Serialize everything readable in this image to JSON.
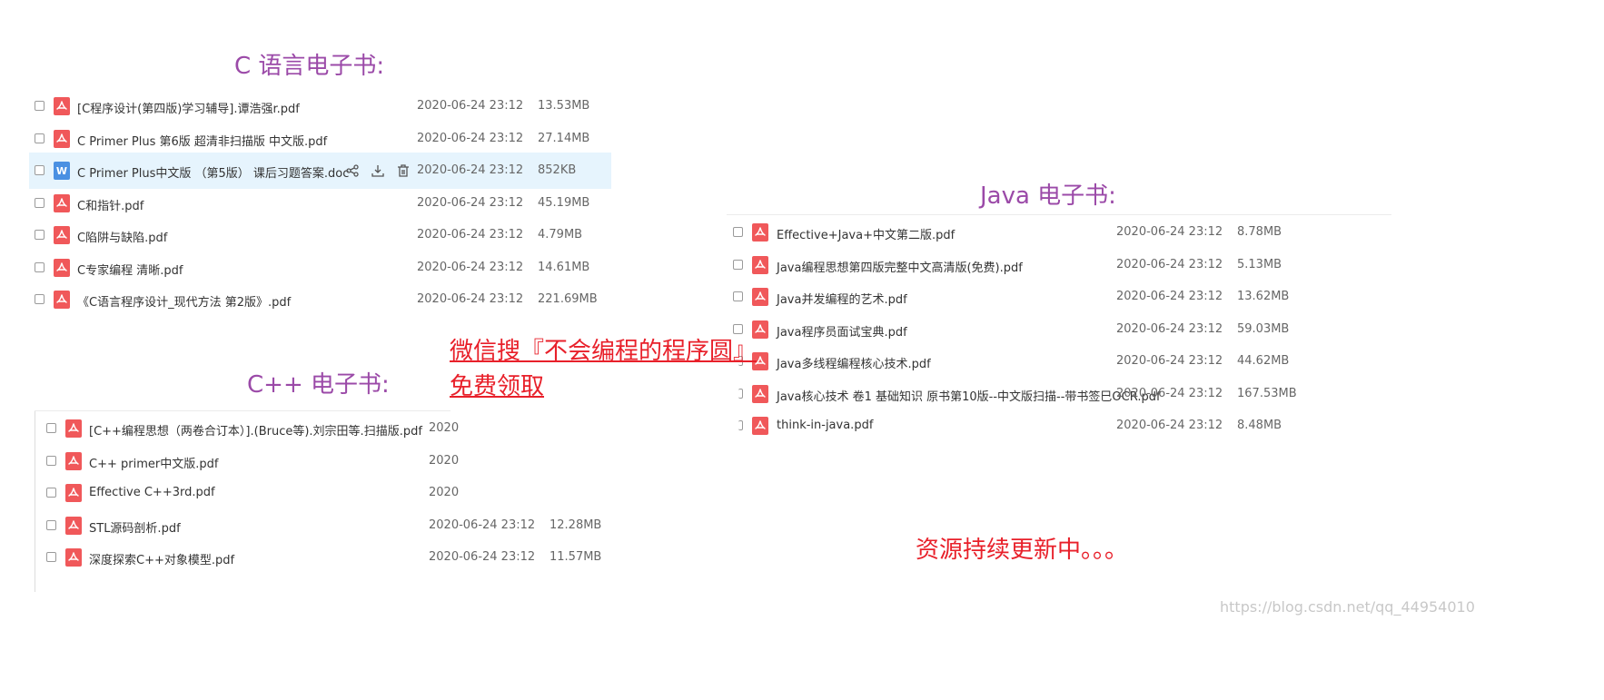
{
  "sections": {
    "c": {
      "title": "C 语言电子书:",
      "files": [
        {
          "name": "[C程序设计(第四版)学习辅导].谭浩强r.pdf",
          "date": "2020-06-24 23:12",
          "size": "13.53MB",
          "type": "pdf"
        },
        {
          "name": "C Primer Plus 第6版 超清非扫描版 中文版.pdf",
          "date": "2020-06-24 23:12",
          "size": "27.14MB",
          "type": "pdf"
        },
        {
          "name": "C Primer Plus中文版 （第5版） 课后习题答案.doc",
          "date": "2020-06-24 23:12",
          "size": "852KB",
          "type": "doc"
        },
        {
          "name": "C和指针.pdf",
          "date": "2020-06-24 23:12",
          "size": "45.19MB",
          "type": "pdf"
        },
        {
          "name": "C陷阱与缺陷.pdf",
          "date": "2020-06-24 23:12",
          "size": "4.79MB",
          "type": "pdf"
        },
        {
          "name": "C专家编程 清晰.pdf",
          "date": "2020-06-24 23:12",
          "size": "14.61MB",
          "type": "pdf"
        },
        {
          "name": "《C语言程序设计_现代方法 第2版》.pdf",
          "date": "2020-06-24 23:12",
          "size": "221.69MB",
          "type": "pdf"
        }
      ]
    },
    "cpp": {
      "title": "C++ 电子书:",
      "files": [
        {
          "name": "[C++编程思想（两卷合订本）].(Bruce等).刘宗田等.扫描版.pdf",
          "date": "2020",
          "size": "",
          "type": "pdf"
        },
        {
          "name": "C++ primer中文版.pdf",
          "date": "2020",
          "size": "",
          "type": "pdf"
        },
        {
          "name": "Effective C++3rd.pdf",
          "date": "2020",
          "size": "",
          "type": "pdf"
        },
        {
          "name": "STL源码剖析.pdf",
          "date": "2020-06-24 23:12",
          "size": "12.28MB",
          "type": "pdf"
        },
        {
          "name": "深度探索C++对象模型.pdf",
          "date": "2020-06-24 23:12",
          "size": "11.57MB",
          "type": "pdf"
        }
      ]
    },
    "java": {
      "title": "Java 电子书:",
      "files": [
        {
          "name": "Effective+Java+中文第二版.pdf",
          "date": "2020-06-24 23:12",
          "size": "8.78MB",
          "type": "pdf"
        },
        {
          "name": "Java编程思想第四版完整中文高清版(免费).pdf",
          "date": "2020-06-24 23:12",
          "size": "5.13MB",
          "type": "pdf"
        },
        {
          "name": "Java并发编程的艺术.pdf",
          "date": "2020-06-24 23:12",
          "size": "13.62MB",
          "type": "pdf"
        },
        {
          "name": "Java程序员面试宝典.pdf",
          "date": "2020-06-24 23:12",
          "size": "59.03MB",
          "type": "pdf"
        },
        {
          "name": "Java多线程编程核心技术.pdf",
          "date": "2020-06-24 23:12",
          "size": "44.62MB",
          "type": "pdf"
        },
        {
          "name": "Java核心技术 卷1 基础知识 原书第10版--中文版扫描--带书签巳OCR.pdf",
          "date": "2020-06-24 23:12",
          "size": "167.53MB",
          "type": "pdf"
        },
        {
          "name": "think-in-java.pdf",
          "date": "2020-06-24 23:12",
          "size": "8.48MB",
          "type": "pdf"
        }
      ]
    }
  },
  "icons": {
    "pdf": "pdf-file-icon",
    "doc": "word-file-icon",
    "doc_letter": "W",
    "share": "share-icon",
    "download": "download-icon",
    "delete": "delete-icon"
  },
  "promo": {
    "line1": "微信搜『不会编程的程序圆』",
    "line2": "免费领取"
  },
  "update_text": "资源持续更新中。。。",
  "watermark": "https://blog.csdn.net/qq_44954010",
  "colors": {
    "title": "#9b4aa8",
    "promo": "#e8202a",
    "pdf": "#f0585a",
    "doc": "#4a90e2",
    "hover_row": "#e6f4fd"
  }
}
